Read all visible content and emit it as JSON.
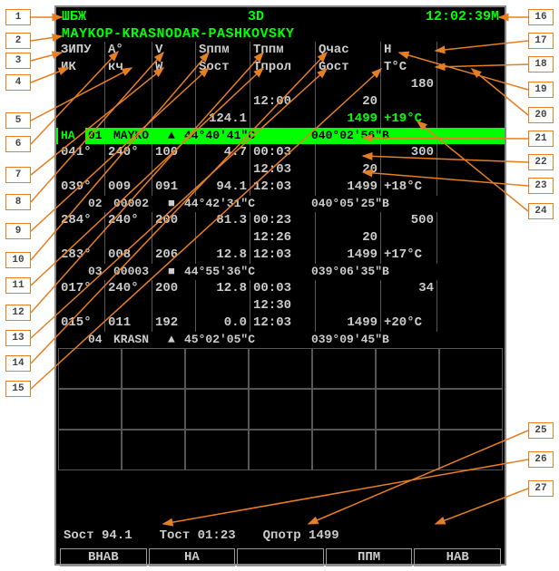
{
  "header": {
    "left": "ШБЖ",
    "center": "3D",
    "right": "12:02:39M"
  },
  "route": "MAYKOP-KRASNODAR-PASHKOVSKY",
  "col_labels_1": {
    "c1": "ЗИПУ",
    "c2": "А°",
    "c3": "V",
    "c4": "Sппм",
    "c5": "Tппм",
    "c6": "Qчас",
    "c7": "H"
  },
  "col_labels_2": {
    "c1": "ИК",
    "c2": "кч",
    "c3": "W",
    "c4": "Sост",
    "c5": "Tпрол",
    "c6": "Gост",
    "c7": "T°C"
  },
  "top_block": {
    "h": "180",
    "time": "12:00",
    "q": "20",
    "g": "1499",
    "temp": "+19°C",
    "s": "124.1"
  },
  "wp_active": {
    "tag": "НА",
    "num": "01",
    "name": "MAYKO",
    "lat": "44°40'41\"C",
    "lon": "040°02'56\"B"
  },
  "seg1": {
    "r1": {
      "c1": "041°",
      "c2": "240°",
      "c3": "100",
      "c4": "4.7",
      "c5": "00:03",
      "c6": "",
      "c7": "300"
    },
    "r2": {
      "c1": "",
      "c2": "",
      "c3": "",
      "c4": "",
      "c5": "12:03",
      "c6": "20",
      "c7": ""
    },
    "r3": {
      "c1": "039°",
      "c2": "009",
      "c3": "091",
      "c4": "94.1",
      "c5": "12:03",
      "c6": "1499",
      "c7": "+18°C"
    }
  },
  "wp2": {
    "num": "02",
    "code": "00002",
    "sym": "■",
    "lat": "44°42'31\"C",
    "lon": "040°05'25\"B"
  },
  "seg2": {
    "r1": {
      "c1": "284°",
      "c2": "240°",
      "c3": "200",
      "c4": "81.3",
      "c5": "00:23",
      "c6": "",
      "c7": "500"
    },
    "r2": {
      "c1": "",
      "c2": "",
      "c3": "",
      "c4": "",
      "c5": "12:26",
      "c6": "20",
      "c7": ""
    },
    "r3": {
      "c1": "283°",
      "c2": "008",
      "c3": "206",
      "c4": "12.8",
      "c5": "12:03",
      "c6": "1499",
      "c7": "+17°C"
    }
  },
  "wp3": {
    "num": "03",
    "code": "00003",
    "sym": "■",
    "lat": "44°55'36\"C",
    "lon": "039°06'35\"B"
  },
  "seg3": {
    "r1": {
      "c1": "017°",
      "c2": "240°",
      "c3": "200",
      "c4": "12.8",
      "c5": "00:03",
      "c6": "",
      "c7": "34"
    },
    "r2": {
      "c1": "",
      "c2": "",
      "c3": "",
      "c4": "",
      "c5": "12:30",
      "c6": "",
      "c7": ""
    },
    "r3": {
      "c1": "015°",
      "c2": "011",
      "c3": "192",
      "c4": "0.0",
      "c5": "12:03",
      "c6": "1499",
      "c7": "+20°C"
    }
  },
  "wp4": {
    "num": "04",
    "code": "KRASN",
    "sym": "▲",
    "lat": "45°02'05\"C",
    "lon": "039°09'45\"B"
  },
  "footer": {
    "sost": "Sост  94.1",
    "tost": "Tост 01:23",
    "qpotr": "Qпотр 1499"
  },
  "buttons": {
    "b1": "ВНАВ",
    "b2": "НА",
    "b3": "",
    "b4": "ППМ",
    "b5": "НАВ"
  },
  "callouts": {
    "1": "1",
    "2": "2",
    "3": "3",
    "4": "4",
    "5": "5",
    "6": "6",
    "7": "7",
    "8": "8",
    "9": "9",
    "10": "10",
    "11": "11",
    "12": "12",
    "13": "13",
    "14": "14",
    "15": "15",
    "16": "16",
    "17": "17",
    "18": "18",
    "19": "19",
    "20": "20",
    "21": "21",
    "22": "22",
    "23": "23",
    "24": "24",
    "25": "25",
    "26": "26",
    "27": "27"
  }
}
